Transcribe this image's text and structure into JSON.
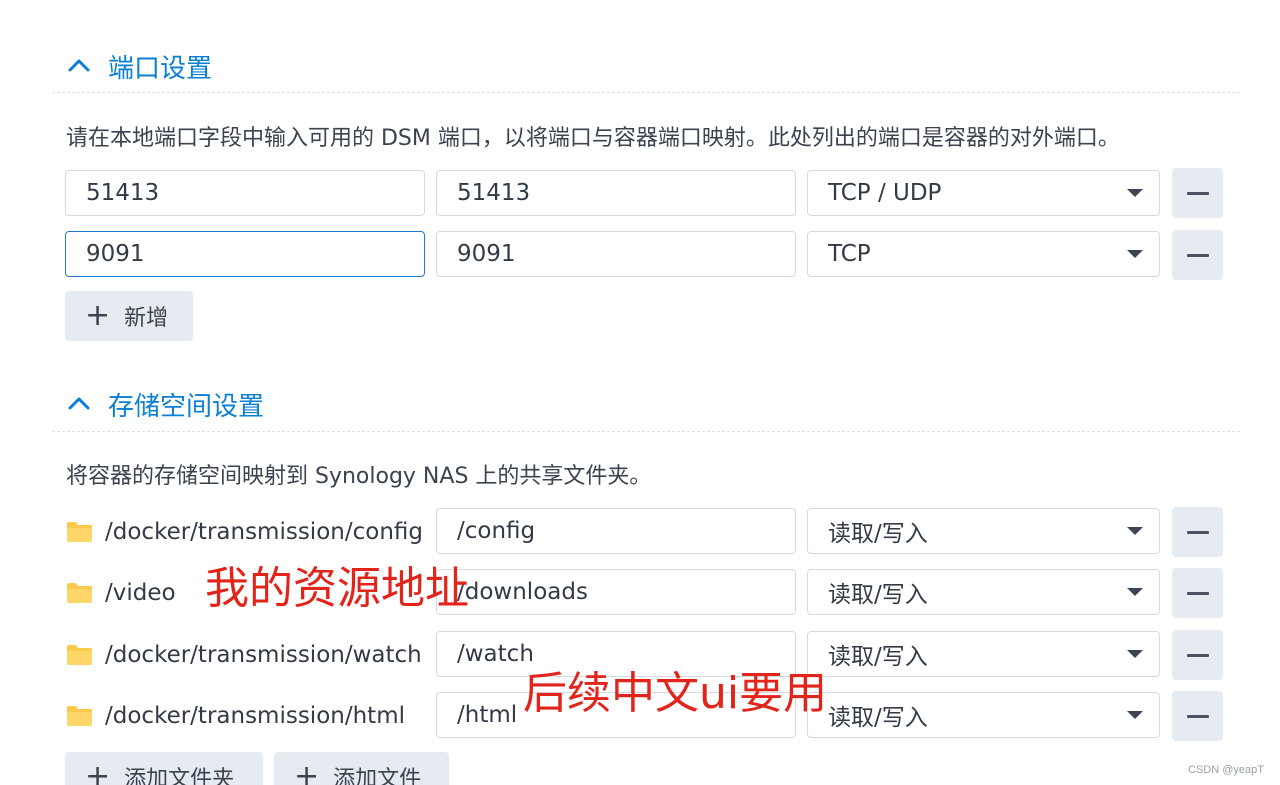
{
  "port_section": {
    "title": "端口设置",
    "description": "请在本地端口字段中输入可用的 DSM 端口，以将端口与容器端口映射。此处列出的端口是容器的对外端口。",
    "rows": [
      {
        "local_port": "51413",
        "container_port": "51413",
        "protocol": "TCP / UDP"
      },
      {
        "local_port": "9091",
        "container_port": "9091",
        "protocol": "TCP"
      }
    ],
    "add_label": "新增"
  },
  "storage_section": {
    "title": "存储空间设置",
    "description": "将容器的存储空间映射到 Synology NAS 上的共享文件夹。",
    "rows": [
      {
        "folder": "/docker/transmission/config",
        "mount_path": "/config",
        "permission": "读取/写入"
      },
      {
        "folder": "/video",
        "mount_path": "/downloads",
        "permission": "读取/写入"
      },
      {
        "folder": "/docker/transmission/watch",
        "mount_path": "/watch",
        "permission": "读取/写入"
      },
      {
        "folder": "/docker/transmission/html",
        "mount_path": "/html",
        "permission": "读取/写入"
      }
    ],
    "add_folder_label": "添加文件夹",
    "add_file_label": "添加文件"
  },
  "annotations": {
    "resource_note": "我的资源地址",
    "ui_note": "后续中文ui要用"
  },
  "watermark": "CSDN @yeapT",
  "colors": {
    "accent": "#0a7fd6",
    "folder": "#fcc94b",
    "annotation": "#e3241b",
    "button_bg": "#e6ebf1"
  },
  "icons": {
    "collapse": "chevron-up-icon",
    "remove": "minus-icon",
    "add": "plus-icon",
    "folder": "folder-icon",
    "dropdown": "caret-down-icon"
  }
}
